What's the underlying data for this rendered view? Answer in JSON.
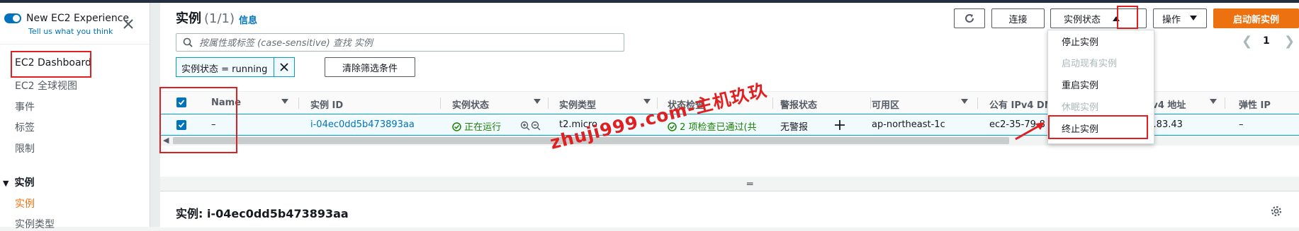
{
  "sidebar": {
    "experience_title": "New EC2 Experience",
    "experience_subtitle": "Tell us what you think",
    "items": [
      {
        "label": "EC2 Dashboard"
      },
      {
        "label": "EC2 全球视图"
      },
      {
        "label": "事件"
      },
      {
        "label": "标签"
      },
      {
        "label": "限制"
      }
    ],
    "group": {
      "label": "实例",
      "items": [
        {
          "label": "实例"
        },
        {
          "label": "实例类型"
        }
      ]
    }
  },
  "header": {
    "title": "实例",
    "count": "(1/1)",
    "info": "信息",
    "buttons": {
      "refresh": "refresh-icon",
      "connect": "连接",
      "instance_state": "实例状态",
      "actions": "操作",
      "launch": "启动新实例"
    }
  },
  "search": {
    "placeholder": "按属性或标签 (case-sensitive) 查找 实例"
  },
  "filter": {
    "token": "实例状态 = running",
    "clear_label": "清除筛选条件"
  },
  "pagination": {
    "page": "1"
  },
  "table": {
    "headers": [
      "Name",
      "实例 ID",
      "实例状态",
      "实例类型",
      "状态检查",
      "警报状态",
      "可用区",
      "公有 IPv4 DN",
      "IPv4 地址",
      "弹性 IP"
    ],
    "row": {
      "name": "–",
      "instance_id": "i-04ec0dd5b473893aa",
      "state": "正在运行",
      "type": "t2.micro",
      "status_check": "2 项检查已通过(共",
      "alarm": "无警报",
      "zone": "ap-northeast-1c",
      "dns": "ec2-35-79-8",
      "ipv4": "78.83.43",
      "elastic_ip": "–"
    }
  },
  "dropdown": {
    "items": [
      {
        "label": "停止实例",
        "enabled": true
      },
      {
        "label": "启动现有实例",
        "enabled": false
      },
      {
        "label": "重启实例",
        "enabled": true
      },
      {
        "label": "休眠实例",
        "enabled": false
      },
      {
        "label": "终止实例",
        "enabled": true
      }
    ]
  },
  "details": {
    "title": "实例: i-04ec0dd5b473893aa"
  },
  "watermark": "zhuji999.com-主机玖玖",
  "colors": {
    "accent": "#ec7211",
    "link": "#0073bb",
    "success": "#1d8102",
    "highlight": "#e02020",
    "nav_dark": "#232f3e"
  }
}
